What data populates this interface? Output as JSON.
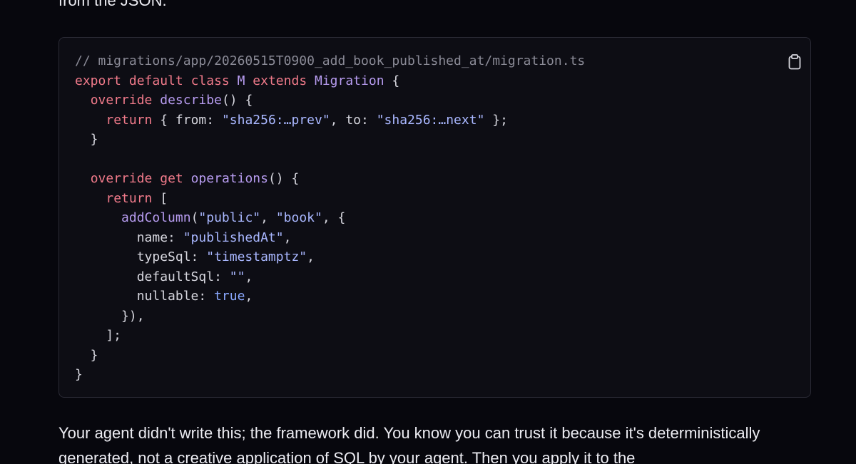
{
  "top_text": "from the JSON.",
  "code_block": {
    "copy_icon": "clipboard-icon",
    "lines": [
      [
        {
          "t": "// migrations/app/20260515T0900_add_book_published_at/migration.ts",
          "k": "cm"
        }
      ],
      [
        {
          "t": "export",
          "k": "kw"
        },
        {
          "t": " ",
          "k": "pn"
        },
        {
          "t": "default",
          "k": "kw"
        },
        {
          "t": " ",
          "k": "pn"
        },
        {
          "t": "class",
          "k": "kw"
        },
        {
          "t": " ",
          "k": "pn"
        },
        {
          "t": "M",
          "k": "ty"
        },
        {
          "t": " ",
          "k": "pn"
        },
        {
          "t": "extends",
          "k": "kw"
        },
        {
          "t": " ",
          "k": "pn"
        },
        {
          "t": "Migration",
          "k": "ty"
        },
        {
          "t": " {",
          "k": "pn"
        }
      ],
      [
        {
          "t": "  ",
          "k": "pn"
        },
        {
          "t": "override",
          "k": "kw"
        },
        {
          "t": " ",
          "k": "pn"
        },
        {
          "t": "describe",
          "k": "fn"
        },
        {
          "t": "() {",
          "k": "pn"
        }
      ],
      [
        {
          "t": "    ",
          "k": "pn"
        },
        {
          "t": "return",
          "k": "kw"
        },
        {
          "t": " { from: ",
          "k": "pn"
        },
        {
          "t": "\"sha256:…prev\"",
          "k": "str"
        },
        {
          "t": ", to: ",
          "k": "pn"
        },
        {
          "t": "\"sha256:…next\"",
          "k": "str"
        },
        {
          "t": " };",
          "k": "pn"
        }
      ],
      [
        {
          "t": "  }",
          "k": "pn"
        }
      ],
      [
        {
          "t": "",
          "k": "pn"
        }
      ],
      [
        {
          "t": "  ",
          "k": "pn"
        },
        {
          "t": "override",
          "k": "kw"
        },
        {
          "t": " ",
          "k": "pn"
        },
        {
          "t": "get",
          "k": "kw"
        },
        {
          "t": " ",
          "k": "pn"
        },
        {
          "t": "operations",
          "k": "fn"
        },
        {
          "t": "() {",
          "k": "pn"
        }
      ],
      [
        {
          "t": "    ",
          "k": "pn"
        },
        {
          "t": "return",
          "k": "kw"
        },
        {
          "t": " [",
          "k": "pn"
        }
      ],
      [
        {
          "t": "      ",
          "k": "pn"
        },
        {
          "t": "addColumn",
          "k": "fn"
        },
        {
          "t": "(",
          "k": "pn"
        },
        {
          "t": "\"public\"",
          "k": "str"
        },
        {
          "t": ", ",
          "k": "pn"
        },
        {
          "t": "\"book\"",
          "k": "str"
        },
        {
          "t": ", {",
          "k": "pn"
        }
      ],
      [
        {
          "t": "        name: ",
          "k": "pn"
        },
        {
          "t": "\"publishedAt\"",
          "k": "str"
        },
        {
          "t": ",",
          "k": "pn"
        }
      ],
      [
        {
          "t": "        typeSql: ",
          "k": "pn"
        },
        {
          "t": "\"timestamptz\"",
          "k": "str"
        },
        {
          "t": ",",
          "k": "pn"
        }
      ],
      [
        {
          "t": "        defaultSql: ",
          "k": "pn"
        },
        {
          "t": "\"\"",
          "k": "str"
        },
        {
          "t": ",",
          "k": "pn"
        }
      ],
      [
        {
          "t": "        nullable: ",
          "k": "pn"
        },
        {
          "t": "true",
          "k": "lit"
        },
        {
          "t": ",",
          "k": "pn"
        }
      ],
      [
        {
          "t": "      }),",
          "k": "pn"
        }
      ],
      [
        {
          "t": "    ];",
          "k": "pn"
        }
      ],
      [
        {
          "t": "  }",
          "k": "pn"
        }
      ],
      [
        {
          "t": "}",
          "k": "pn"
        }
      ]
    ]
  },
  "paragraph": "Your agent didn't write this; the framework did. You know you can trust it because it's deterministically generated, not a creative application of SQL by your agent. Then you apply it to the",
  "colors": {
    "background": "#07070d",
    "code_background": "#0d0d14",
    "keyword": "#f07a8a",
    "type_function": "#b79cf0",
    "string": "#a9b7ff",
    "literal": "#8aa8ff",
    "comment": "#8a8a96"
  }
}
